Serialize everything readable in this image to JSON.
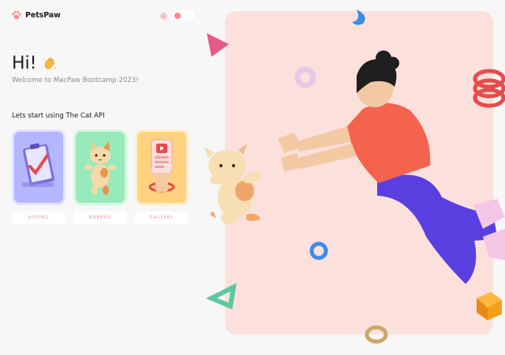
{
  "header": {
    "logo_text": "PetsPaw",
    "logo_icon": "paw-icon",
    "theme_icon": "eye-icon",
    "theme_toggle_color": "#ff868e"
  },
  "hero": {
    "title": "Hi!",
    "title_icon": "waving-hand-icon",
    "welcome": "Welcome to MacPaw Bootcamp 2023!",
    "start_text": "Lets start using The Cat API"
  },
  "cards": [
    {
      "label": "VOTING",
      "color": "#b4b7ff",
      "icon": "clipboard-vote-icon"
    },
    {
      "label": "BREEDS",
      "color": "#97eab9",
      "icon": "cat-breeds-icon"
    },
    {
      "label": "GALLERY",
      "color": "#ffd280",
      "icon": "phone-gallery-icon"
    }
  ],
  "colors": {
    "accent": "#ff868e",
    "hero_background": "#fbe0dc",
    "page_background": "#f8f7f7"
  }
}
